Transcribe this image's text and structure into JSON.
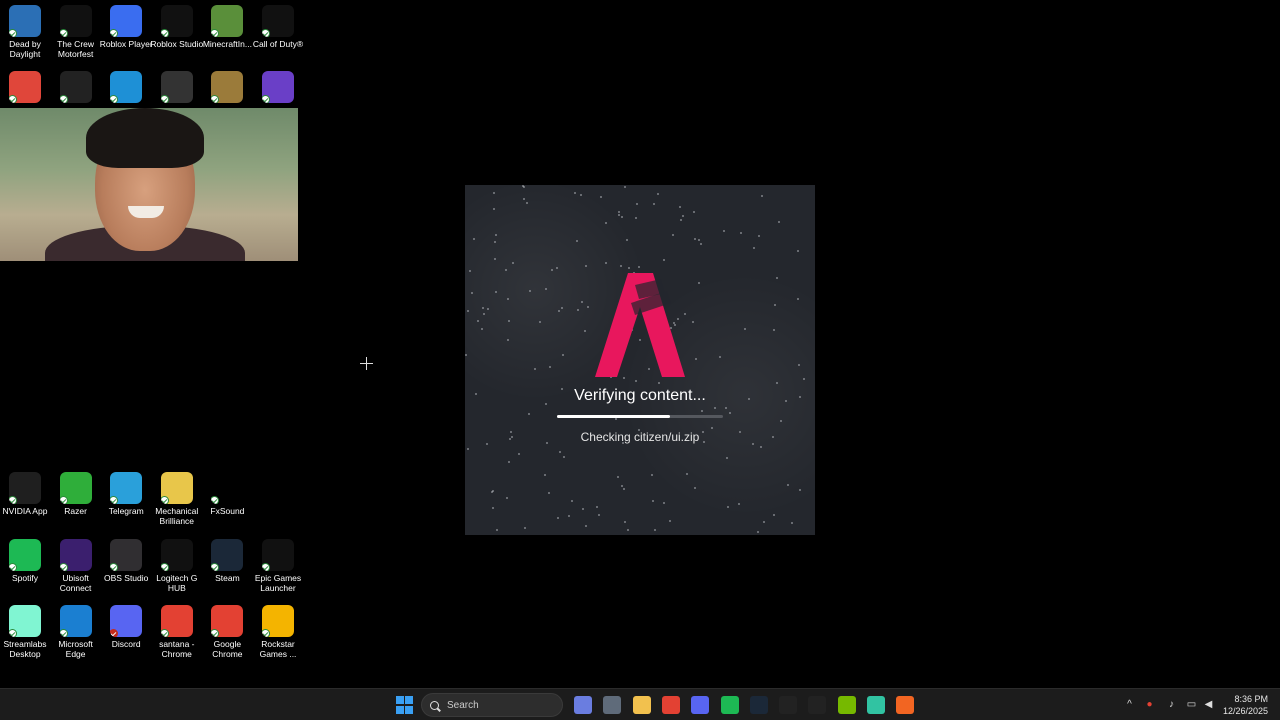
{
  "desktop": {
    "top_icons_row1": [
      {
        "label": "Dead by Daylight",
        "icon": "dead-by-daylight-icon",
        "color": "#2b6fb5"
      },
      {
        "label": "The Crew Motorfest",
        "icon": "the-crew-motorfest-icon",
        "color": "#111111"
      },
      {
        "label": "Roblox Player",
        "icon": "roblox-player-icon",
        "color": "#3a6df0"
      },
      {
        "label": "Roblox Studio",
        "icon": "roblox-studio-icon",
        "color": "#111111"
      },
      {
        "label": "MinecraftIn...",
        "icon": "minecraft-icon",
        "color": "#5a8f3a"
      },
      {
        "label": "Call of Duty®",
        "icon": "call-of-duty-icon",
        "color": "#111111"
      }
    ],
    "top_icons_row2": [
      {
        "icon": "game-anime-icon",
        "color": "#e0463a"
      },
      {
        "icon": "settings-app-icon",
        "color": "#222222"
      },
      {
        "icon": "fortnite-icon",
        "color": "#1e90d6"
      },
      {
        "icon": "rainbow-six-icon",
        "color": "#333333"
      },
      {
        "icon": "skate-icon",
        "color": "#9b7b3a"
      },
      {
        "icon": "purple-cube-icon",
        "color": "#6a3fc7"
      }
    ],
    "bottom_icons_row1": [
      {
        "label": "NVIDIA App",
        "icon": "nvidia-icon",
        "color": "#1f1f1f"
      },
      {
        "label": "Razer",
        "icon": "razer-icon",
        "color": "#2fae3a"
      },
      {
        "label": "Telegram",
        "icon": "telegram-icon",
        "color": "#2aa0da"
      },
      {
        "label": "Mechanical Brilliance",
        "icon": "folder-icon",
        "color": "#e8c64a"
      },
      {
        "label": "FxSound",
        "icon": "fxsound-icon",
        "color": "#000000"
      }
    ],
    "bottom_icons_row2": [
      {
        "label": "Spotify",
        "icon": "spotify-icon",
        "color": "#1db954"
      },
      {
        "label": "Ubisoft Connect",
        "icon": "ubisoft-icon",
        "color": "#3b1f6e"
      },
      {
        "label": "OBS Studio",
        "icon": "obs-icon",
        "color": "#302e31"
      },
      {
        "label": "Logitech G HUB",
        "icon": "logitech-icon",
        "color": "#111111"
      },
      {
        "label": "Steam",
        "icon": "steam-icon",
        "color": "#1b2838"
      },
      {
        "label": "Epic Games Launcher",
        "icon": "epic-games-icon",
        "color": "#111111"
      }
    ],
    "bottom_icons_row3": [
      {
        "label": "Streamlabs Desktop",
        "icon": "streamlabs-icon",
        "color": "#80f5d2"
      },
      {
        "label": "Microsoft Edge",
        "icon": "edge-icon",
        "color": "#1b7fd1"
      },
      {
        "label": "Discord",
        "icon": "discord-icon",
        "color": "#5865f2"
      },
      {
        "label": "santana - Chrome",
        "icon": "chrome-profile-icon",
        "color": "#e34133"
      },
      {
        "label": "Google Chrome",
        "icon": "chrome-icon",
        "color": "#e34133"
      },
      {
        "label": "Rockstar Games ...",
        "icon": "rockstar-icon",
        "color": "#f4b400"
      }
    ]
  },
  "launcher": {
    "title": "Verifying content...",
    "subtitle": "Checking citizen/ui.zip",
    "progress": 0.68,
    "accent": "#e8175d"
  },
  "taskbar": {
    "search_placeholder": "Search",
    "clock_time": "8:36 PM",
    "clock_date": "12/26/2025",
    "pinned": [
      {
        "icon": "widgets-icon",
        "color": "#6a7de0"
      },
      {
        "icon": "settings-icon",
        "color": "#5f6b7a"
      },
      {
        "icon": "file-explorer-icon",
        "color": "#f2c14e"
      },
      {
        "icon": "chrome-icon",
        "color": "#e34133"
      },
      {
        "icon": "discord-icon",
        "color": "#5865f2"
      },
      {
        "icon": "spotify-icon",
        "color": "#1db954"
      },
      {
        "icon": "steam-icon",
        "color": "#1b2838"
      },
      {
        "icon": "epic-games-icon",
        "color": "#222222"
      },
      {
        "icon": "logitech-icon",
        "color": "#222222"
      },
      {
        "icon": "nvidia-icon",
        "color": "#76b900"
      },
      {
        "icon": "streamlabs-icon",
        "color": "#31c3a2"
      },
      {
        "icon": "fivem-icon",
        "color": "#f26522"
      }
    ]
  }
}
